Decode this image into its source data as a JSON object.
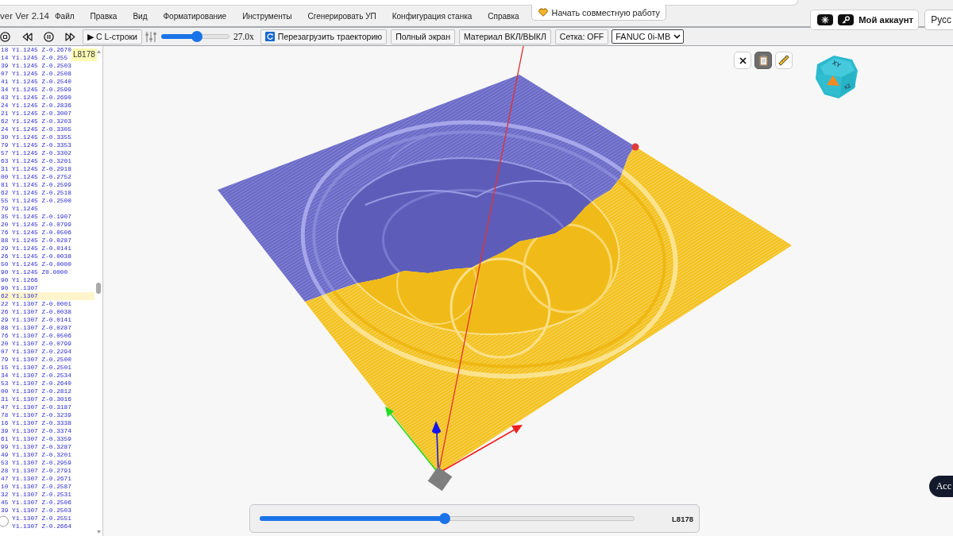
{
  "menu_bar": {
    "app_title": "ver Ver 2.14",
    "items": [
      "Файл",
      "Правка",
      "Вид",
      "Форматирование",
      "Инструменты",
      "Сгенерировать УП",
      "Конфигурация станка",
      "Справка"
    ],
    "collab_button": "Начать совместную работу",
    "account_button": "Мой аккаунт",
    "language_button": "Русс"
  },
  "toolbar": {
    "run_from_line_button": "▶ С L-строки",
    "speed": {
      "level": 0.52,
      "reading": "27.0x"
    },
    "buttons": [
      {
        "label": "Перезагрузить траекторию",
        "kind": "icon"
      },
      {
        "label": "Полный экран",
        "kind": "plain"
      },
      {
        "label": "Материал ВКЛ/ВЫКЛ",
        "kind": "plain"
      },
      {
        "label": "Сетка: OFF",
        "kind": "plain"
      }
    ],
    "machine_select": {
      "value": "FANUC 0i-MB"
    }
  },
  "code_panel": {
    "tooltip": "L8178",
    "lines": [
      {
        "text": "18 Y1.1245 Z-0.2670",
        "kind": "line",
        "selected": false
      },
      {
        "text": "14 Y1.1245 Z-0.255",
        "kind": "line",
        "selected": false
      },
      {
        "text": "39 Y1.1245 Z-0.2503",
        "kind": "line",
        "selected": false
      },
      {
        "text": "07 Y1.1245 Z-0.2508",
        "kind": "line",
        "selected": false
      },
      {
        "text": "41 Y1.1245 Z-0.2540",
        "kind": "line",
        "selected": false
      },
      {
        "text": "34 Y1.1245 Z-0.2599",
        "kind": "line",
        "selected": false
      },
      {
        "text": "43 Y1.1245 Z-0.2690",
        "kind": "line",
        "selected": false
      },
      {
        "text": "24 Y1.1245 Z-0.2836",
        "kind": "line",
        "selected": false
      },
      {
        "text": "21 Y1.1245 Z-0.3007",
        "kind": "line",
        "selected": false
      },
      {
        "text": "62 Y1.1245 Z-0.3203",
        "kind": "line",
        "selected": false
      },
      {
        "text": "24 Y1.1245 Z-0.3305",
        "kind": "line",
        "selected": false
      },
      {
        "text": "30 Y1.1245 Z-0.3355",
        "kind": "line",
        "selected": false
      },
      {
        "text": "79 Y1.1245 Z-0.3353",
        "kind": "line",
        "selected": false
      },
      {
        "text": "57 Y1.1245 Z-0.3302",
        "kind": "line",
        "selected": false
      },
      {
        "text": "63 Y1.1245 Z-0.3201",
        "kind": "line",
        "selected": false
      },
      {
        "text": "31 Y1.1245 Z-0.2918",
        "kind": "line",
        "selected": false
      },
      {
        "text": "00 Y1.1245 Z-0.2752",
        "kind": "line",
        "selected": false
      },
      {
        "text": "81 Y1.1245 Z-0.2599",
        "kind": "line",
        "selected": false
      },
      {
        "text": "62 Y1.1245 Z-0.2518",
        "kind": "line",
        "selected": false
      },
      {
        "text": "55 Y1.1245 Z-0.2500",
        "kind": "line",
        "selected": false
      },
      {
        "text": "79 Y1.1245",
        "kind": "line",
        "selected": false
      },
      {
        "text": "35 Y1.1245 Z-0.1907",
        "kind": "line",
        "selected": false
      },
      {
        "text": "20 Y1.1245 Z-0.0799",
        "kind": "line",
        "selected": false
      },
      {
        "text": "76 Y1.1245 Z-0.0506",
        "kind": "line",
        "selected": false
      },
      {
        "text": "88 Y1.1245 Z-0.0287",
        "kind": "line",
        "selected": false
      },
      {
        "text": "29 Y1.1245 Z-0.0141",
        "kind": "line",
        "selected": false
      },
      {
        "text": "26 Y1.1245 Z-0.0038",
        "kind": "line",
        "selected": false
      },
      {
        "text": "50 Y1.1245 Z-0.0000",
        "kind": "line",
        "selected": false
      },
      {
        "text": "90 Y1.1245 Z0.0000",
        "kind": "line",
        "selected": false
      },
      {
        "text": "90 Y1.1266",
        "kind": "line",
        "selected": false
      },
      {
        "text": "90 Y1.1307",
        "kind": "line",
        "selected": false
      },
      {
        "text": "62 Y1.1307",
        "kind": "line",
        "selected": true
      },
      {
        "text": "22 Y1.1307 Z-0.0001",
        "kind": "line",
        "selected": false
      },
      {
        "text": "26 Y1.1307 Z-0.0038",
        "kind": "line",
        "selected": false
      },
      {
        "text": "29 Y1.1307 Z-0.0141",
        "kind": "line",
        "selected": false
      },
      {
        "text": "88 Y1.1307 Z-0.0287",
        "kind": "line",
        "selected": false
      },
      {
        "text": "76 Y1.1307 Z-0.0506",
        "kind": "line",
        "selected": false
      },
      {
        "text": "20 Y1.1307 Z-0.0799",
        "kind": "line",
        "selected": false
      },
      {
        "text": "07 Y1.1307 Z-0.2294",
        "kind": "line",
        "selected": false
      },
      {
        "text": "79 Y1.1307 Z-0.2500",
        "kind": "line",
        "selected": false
      },
      {
        "text": "15 Y1.1307 Z-0.2501",
        "kind": "line",
        "selected": false
      },
      {
        "text": "34 Y1.1307 Z-0.2534",
        "kind": "line",
        "selected": false
      },
      {
        "text": "53 Y1.1307 Z-0.2640",
        "kind": "line",
        "selected": false
      },
      {
        "text": "00 Y1.1307 Z-0.2812",
        "kind": "line",
        "selected": false
      },
      {
        "text": "31 Y1.1307 Z-0.3016",
        "kind": "line",
        "selected": false
      },
      {
        "text": "47 Y1.1307 Z-0.3187",
        "kind": "line",
        "selected": false
      },
      {
        "text": "78 Y1.1307 Z-0.3239",
        "kind": "line",
        "selected": false
      },
      {
        "text": "16 Y1.1307 Z-0.3338",
        "kind": "line",
        "selected": false
      },
      {
        "text": "39 Y1.1307 Z-0.3374",
        "kind": "line",
        "selected": false
      },
      {
        "text": "61 Y1.1307 Z-0.3359",
        "kind": "line",
        "selected": false
      },
      {
        "text": "99 Y1.1307 Z-0.3287",
        "kind": "line",
        "selected": false
      },
      {
        "text": "49 Y1.1307 Z-0.3201",
        "kind": "line",
        "selected": false
      },
      {
        "text": "53 Y1.1307 Z-0.2959",
        "kind": "line",
        "selected": false
      },
      {
        "text": "28 Y1.1307 Z-0.2791",
        "kind": "line",
        "selected": false
      },
      {
        "text": "47 Y1.1307 Z-0.2671",
        "kind": "line",
        "selected": false
      },
      {
        "text": "10 Y1.1307 Z-0.2587",
        "kind": "line",
        "selected": false
      },
      {
        "text": "32 Y1.1307 Z-0.2531",
        "kind": "line",
        "selected": false
      },
      {
        "text": "45 Y1.1307 Z-0.2506",
        "kind": "line",
        "selected": false
      },
      {
        "text": "39 Y1.1307 Z-0.2503",
        "kind": "line",
        "selected": false
      },
      {
        "text": "Y1.1307 Z-0.2551",
        "kind": "covered",
        "selected": false
      },
      {
        "text": "Y1.1307 Z-0.2664",
        "kind": "covered",
        "selected": false
      }
    ]
  },
  "viewport": {
    "tool_buttons": [
      {
        "kind": "close",
        "selected": false
      },
      {
        "kind": "clipboard",
        "selected": true
      },
      {
        "kind": "ruler",
        "selected": false
      }
    ],
    "view_cube": {
      "labels": [
        "XY",
        "XZ"
      ]
    },
    "line_slider": {
      "level": 0.494,
      "reading": "L8178"
    },
    "floating_button": "Acc"
  }
}
